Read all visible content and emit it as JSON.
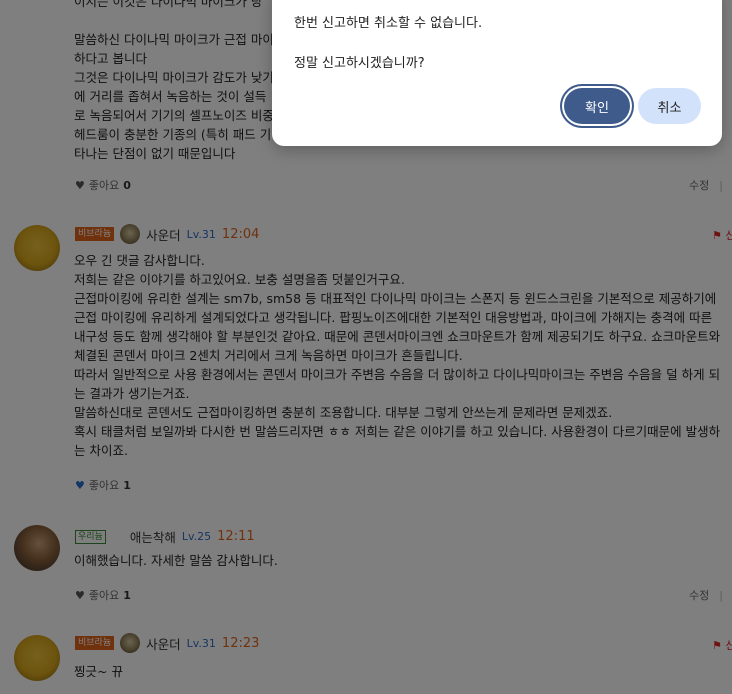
{
  "comment0": {
    "lines": [
      "이지는 이것은 다이나믹 마이크가 당",
      "",
      "말씀하신 다이나믹 마이크가 근접 마이",
      "하다고 봅니다",
      "그것은 다이나믹 마이크가 감도가 낮기",
      "에 거리를 좁혀서 녹음하는 것이 설득",
      "로 녹음되어서 기기의 셀프노이즈 비중",
      "헤드룸이 충분한 기종의 (특히 패드 기",
      "타나는 단점이 없기 때문입니다"
    ],
    "likes_label": "좋아요",
    "likes_count": "0",
    "edit": "수정",
    "sep": "|"
  },
  "comment1": {
    "badge": "비브라늄",
    "nickname": "사운더",
    "level": "Lv.31",
    "time": "12:04",
    "report": "신",
    "lines": [
      "오우 긴 댓글 감사합니다.",
      "저희는 같은 이야기를 하고있어요.  보충 설명을좀 덧붙인거구요.",
      "근접마이킹에 유리한 설계는  sm7b, sm58 등 대표적인 다이나믹 마이크는 스폰지 등 윈드스크린을 기본적으로 제공하기에",
      "근접 마이킹에 유리하게 설계되었다고 생각됩니다. 팝핑노이즈에대한 기본적인 대응방법과, 마이크에 가해지는 충격에 따른",
      "내구성 등도 함께 생각해야 할 부분인것 같아요. 때문에 콘덴서마이크엔 쇼크마운트가 함께 제공되기도 하구요. 쇼크마운트와",
      "체결된 콘덴서 마이크 2센치 거리에서 크게 녹음하면 마이크가 흔들립니다.",
      "따라서 일반적으로 사용 환경에서는 콘덴서 마이크가 주변음 수음을 더 많이하고 다이나믹마이크는 주변음 수음을 덜 하게 되",
      "는 결과가 생기는거죠.",
      "말씀하신대로 콘덴서도 근접마이킹하면 충분히 조용합니다. 대부분 그렇게 안쓰는게 문제라면 문제겠죠.",
      "혹시 태클처럼 보일까봐 다시한 번 말씀드리자면 ㅎㅎ 저희는 같은 이야기를 하고 있습니다. 사용환경이 다르기때문에 발생하",
      "는 차이죠."
    ],
    "likes_label": "좋아요",
    "likes_count": "1"
  },
  "comment2": {
    "badge": "우리늄",
    "nickname": "애는착해",
    "level": "Lv.25",
    "time": "12:11",
    "lines": [
      "이해했습니다. 자세한 말씀 감사합니다."
    ],
    "likes_label": "좋아요",
    "likes_count": "1",
    "edit": "수정",
    "sep": "|"
  },
  "comment3": {
    "badge": "비브라늄",
    "nickname": "사운더",
    "level": "Lv.31",
    "time": "12:23",
    "report": "신",
    "lines": [
      "찡긋~ 뀨"
    ]
  },
  "dialog": {
    "line1": "한번 신고하면 취소할 수 없습니다.",
    "line2": "정말 신고하시겠습니까?",
    "confirm": "확인",
    "cancel": "취소"
  },
  "icons": {
    "heart": "heart-icon",
    "flag": "flag-icon"
  },
  "colors": {
    "accent_orange": "#e0631b",
    "level_blue": "#2c6cc8",
    "confirm_button": "#3f5b8c",
    "cancel_button": "#d3e2fb"
  }
}
